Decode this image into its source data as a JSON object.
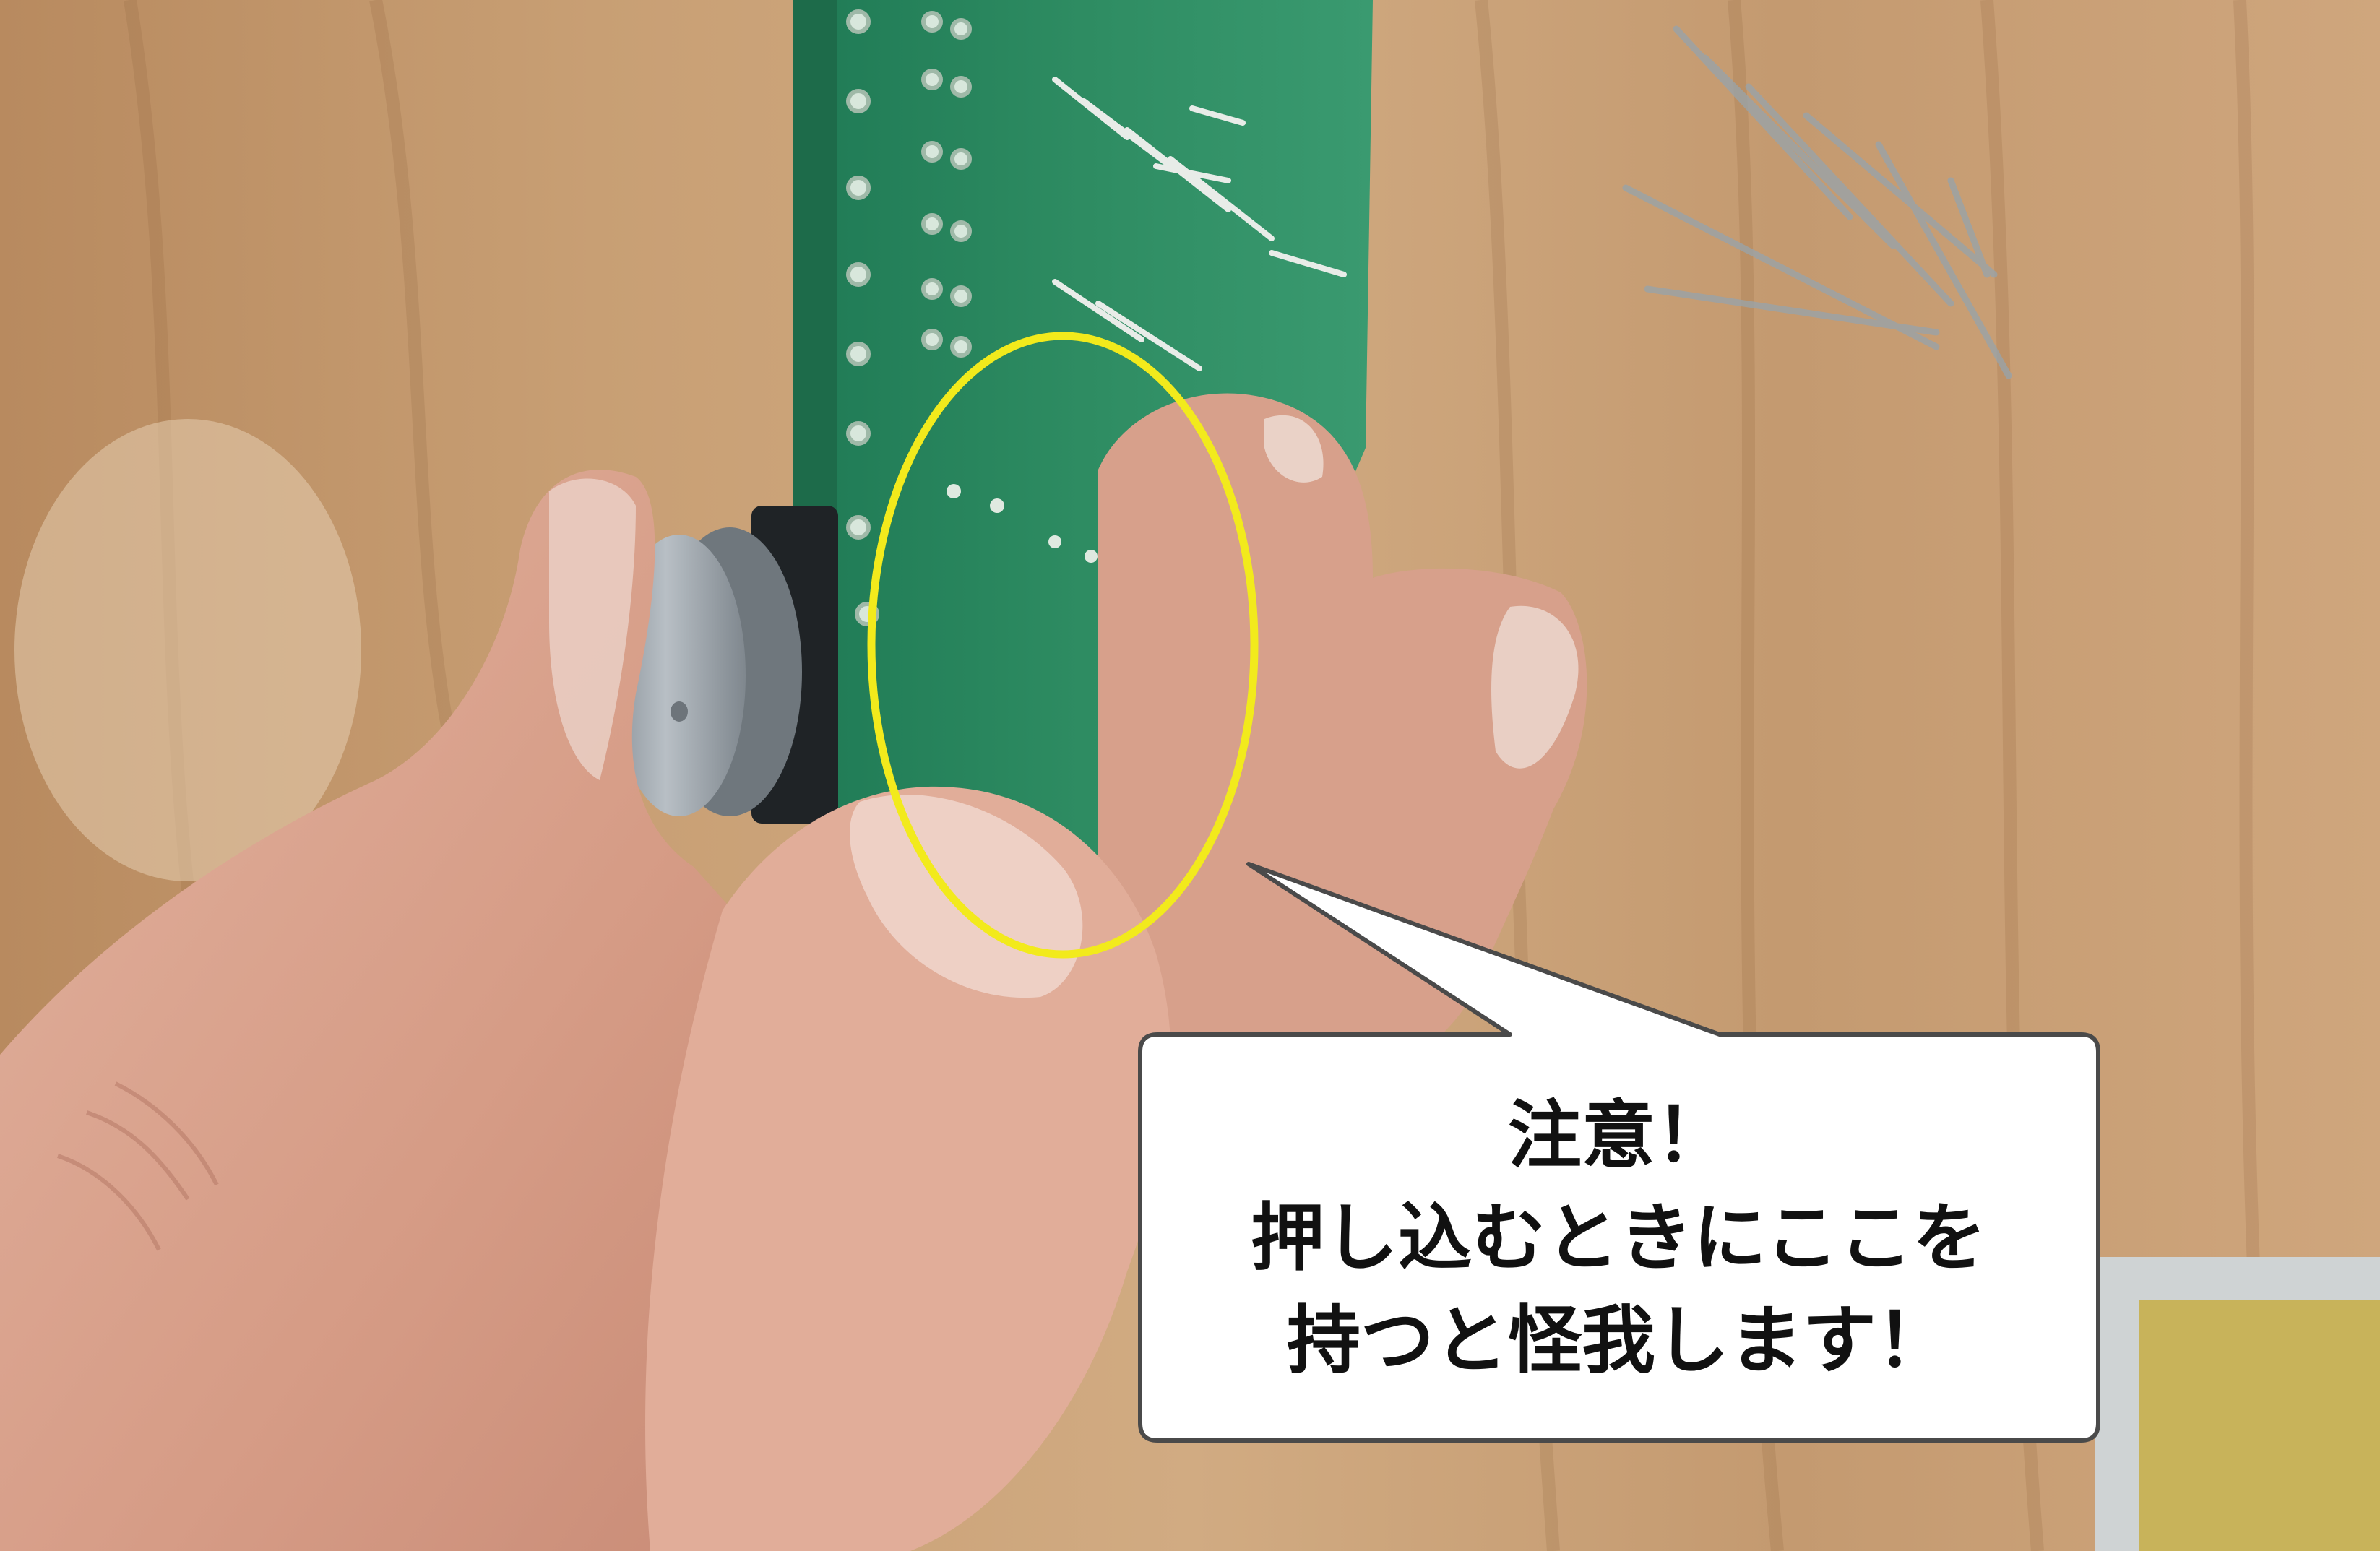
{
  "photo": {
    "subject": "hand-pressing-component-into-circuit-board",
    "colors": {
      "table": "#c9a17a",
      "board": "#2d8a62",
      "skin": "#d9a48f",
      "highlight_ellipse": "#f2ea1c",
      "callout_fill": "#ffffff",
      "callout_stroke": "#4a4a4a"
    }
  },
  "callout": {
    "line1": "注意！",
    "line2": "押し込むときにここを",
    "line3": "持つと怪我します！"
  }
}
